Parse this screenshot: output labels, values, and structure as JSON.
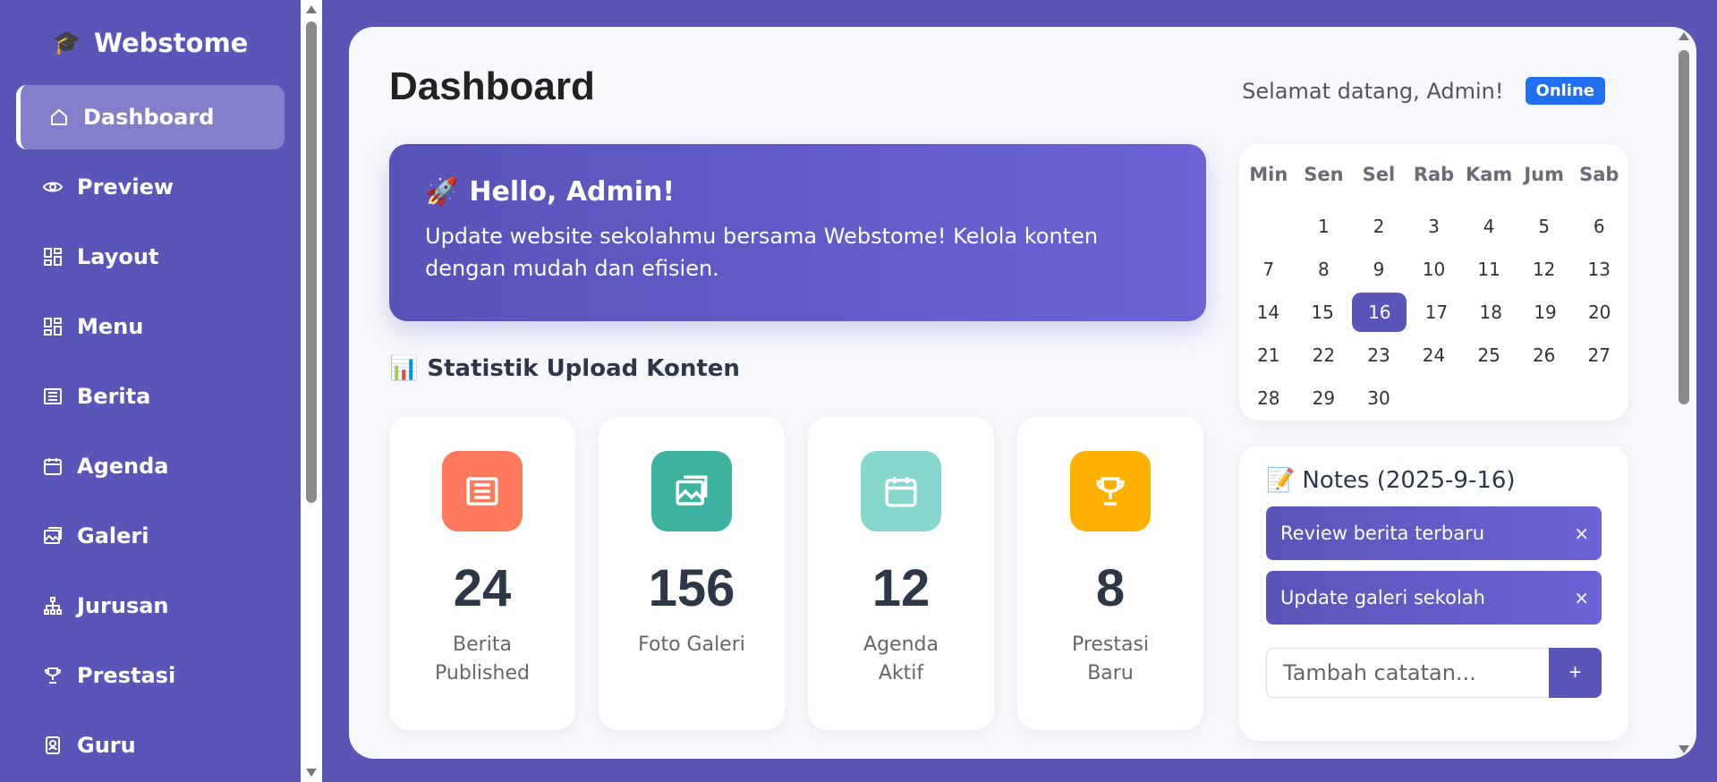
{
  "brand": {
    "icon": "graduation-cap-icon",
    "name": "Webstome"
  },
  "sidebar": {
    "items": [
      {
        "label": "Dashboard",
        "icon": "home-icon",
        "active": true
      },
      {
        "label": "Preview",
        "icon": "eye-icon"
      },
      {
        "label": "Layout",
        "icon": "grid-icon"
      },
      {
        "label": "Menu",
        "icon": "grid-icon"
      },
      {
        "label": "Berita",
        "icon": "newspaper-icon"
      },
      {
        "label": "Agenda",
        "icon": "calendar-icon"
      },
      {
        "label": "Galeri",
        "icon": "images-icon"
      },
      {
        "label": "Jurusan",
        "icon": "sitemap-icon"
      },
      {
        "label": "Prestasi",
        "icon": "trophy-icon"
      },
      {
        "label": "Guru",
        "icon": "id-badge-icon"
      }
    ]
  },
  "header": {
    "title": "Dashboard",
    "welcome": "Selamat datang, Admin!",
    "status_badge": "Online"
  },
  "hello_card": {
    "icon": "rocket-icon",
    "title": "Hello, Admin!",
    "text": "Update website sekolahmu bersama Webstome! Kelola konten dengan mudah dan efisien."
  },
  "stats": {
    "icon": "bar-chart-icon",
    "title": "Statistik Upload Konten",
    "cards": [
      {
        "value": "24",
        "label": "Berita Published",
        "icon": "newspaper-icon",
        "color": "#ff7a5c"
      },
      {
        "value": "156",
        "label": "Foto Galeri",
        "icon": "images-icon",
        "color": "#3bb3a0"
      },
      {
        "value": "12",
        "label": "Agenda Aktif",
        "icon": "calendar-icon",
        "color": "#86d8cf"
      },
      {
        "value": "8",
        "label": "Prestasi Baru",
        "icon": "trophy-icon",
        "color": "#ffb000"
      }
    ]
  },
  "calendar": {
    "weekdays": [
      "Min",
      "Sen",
      "Sel",
      "Rab",
      "Kam",
      "Jum",
      "Sab"
    ],
    "weeks": [
      [
        "",
        "1",
        "2",
        "3",
        "4",
        "5",
        "6"
      ],
      [
        "7",
        "8",
        "9",
        "10",
        "11",
        "12",
        "13"
      ],
      [
        "14",
        "15",
        "16",
        "17",
        "18",
        "19",
        "20"
      ],
      [
        "21",
        "22",
        "23",
        "24",
        "25",
        "26",
        "27"
      ],
      [
        "28",
        "29",
        "30",
        "",
        "",
        "",
        ""
      ]
    ],
    "today": "16"
  },
  "notes": {
    "icon": "memo-icon",
    "title": "Notes (2025-9-16)",
    "items": [
      {
        "text": "Review berita terbaru",
        "remove": "×"
      },
      {
        "text": "Update galeri sekolah",
        "remove": "×"
      }
    ],
    "input_placeholder": "Tambah catatan...",
    "add_label": "+"
  },
  "colors": {
    "primary": "#5a55b8",
    "badge": "#1f6ff0"
  }
}
